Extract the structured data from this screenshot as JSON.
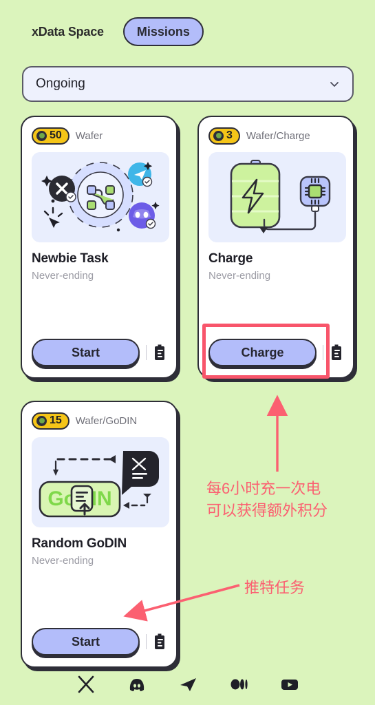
{
  "header": {
    "brand": "xData Space",
    "tab_label": "Missions"
  },
  "filter": {
    "value": "Ongoing",
    "chevron_icon": "chevron-down-icon"
  },
  "cards": [
    {
      "id": "newbie",
      "reward_amount": "50",
      "reward_unit": "Wafer",
      "coin_icon": "wafer-coin-icon",
      "illustration": "social-network-connect-illustration",
      "title": "Newbie Task",
      "subtitle": "Never-ending",
      "action_label": "Start",
      "list_icon": "task-list-icon"
    },
    {
      "id": "charge",
      "reward_amount": "3",
      "reward_unit": "Wafer/Charge",
      "coin_icon": "wafer-coin-icon",
      "illustration": "battery-charging-illustration",
      "title": "Charge",
      "subtitle": "Never-ending",
      "action_label": "Charge",
      "list_icon": "task-list-icon"
    },
    {
      "id": "godin",
      "reward_amount": "15",
      "reward_unit": "Wafer/GoDIN",
      "coin_icon": "wafer-coin-icon",
      "illustration": "godin-post-illustration",
      "title": "Random GoDIN",
      "subtitle": "Never-ending",
      "action_label": "Start",
      "list_icon": "task-list-icon"
    }
  ],
  "annotations": {
    "charge_note_line1": "每6小时充一次电",
    "charge_note_line2": "可以获得额外积分",
    "twitter_note": "推特任务",
    "color": "#fb6071",
    "highlight_box_color": "#f8556b"
  },
  "bottom_nav": [
    {
      "name": "x-twitter-icon",
      "label": "X"
    },
    {
      "name": "discord-icon",
      "label": "Discord"
    },
    {
      "name": "telegram-icon",
      "label": "Telegram"
    },
    {
      "name": "medium-icon",
      "label": "Medium"
    },
    {
      "name": "youtube-icon",
      "label": "YouTube"
    }
  ],
  "theme": {
    "background": "#dbf4bc",
    "accent": "#b3bdfa",
    "coin": "#f5c518",
    "ink": "#2e2e38",
    "illustration_bg": "#e9eefd",
    "green": "#c7ef9b"
  }
}
